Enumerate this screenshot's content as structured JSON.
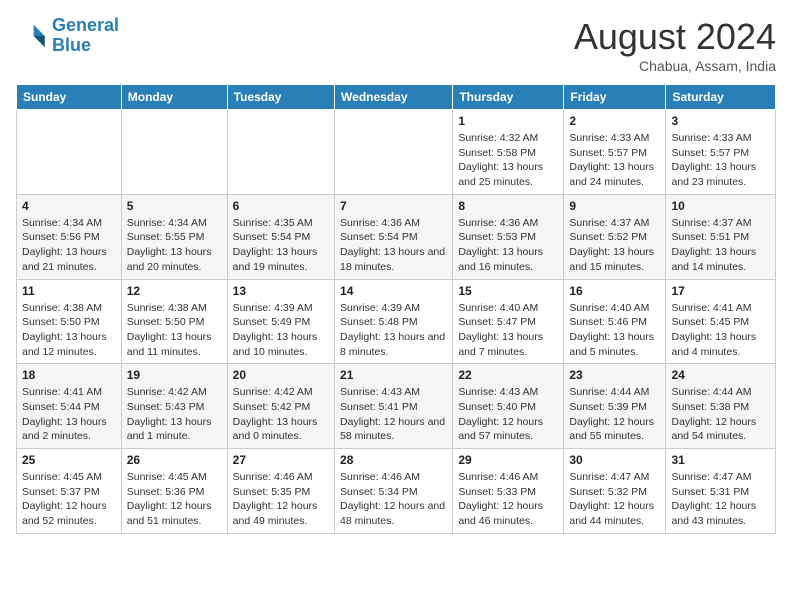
{
  "header": {
    "logo_line1": "General",
    "logo_line2": "Blue",
    "month": "August 2024",
    "location": "Chabua, Assam, India"
  },
  "days_of_week": [
    "Sunday",
    "Monday",
    "Tuesday",
    "Wednesday",
    "Thursday",
    "Friday",
    "Saturday"
  ],
  "weeks": [
    [
      {
        "day": "",
        "info": ""
      },
      {
        "day": "",
        "info": ""
      },
      {
        "day": "",
        "info": ""
      },
      {
        "day": "",
        "info": ""
      },
      {
        "day": "1",
        "info": "Sunrise: 4:32 AM\nSunset: 5:58 PM\nDaylight: 13 hours and 25 minutes."
      },
      {
        "day": "2",
        "info": "Sunrise: 4:33 AM\nSunset: 5:57 PM\nDaylight: 13 hours and 24 minutes."
      },
      {
        "day": "3",
        "info": "Sunrise: 4:33 AM\nSunset: 5:57 PM\nDaylight: 13 hours and 23 minutes."
      }
    ],
    [
      {
        "day": "4",
        "info": "Sunrise: 4:34 AM\nSunset: 5:56 PM\nDaylight: 13 hours and 21 minutes."
      },
      {
        "day": "5",
        "info": "Sunrise: 4:34 AM\nSunset: 5:55 PM\nDaylight: 13 hours and 20 minutes."
      },
      {
        "day": "6",
        "info": "Sunrise: 4:35 AM\nSunset: 5:54 PM\nDaylight: 13 hours and 19 minutes."
      },
      {
        "day": "7",
        "info": "Sunrise: 4:36 AM\nSunset: 5:54 PM\nDaylight: 13 hours and 18 minutes."
      },
      {
        "day": "8",
        "info": "Sunrise: 4:36 AM\nSunset: 5:53 PM\nDaylight: 13 hours and 16 minutes."
      },
      {
        "day": "9",
        "info": "Sunrise: 4:37 AM\nSunset: 5:52 PM\nDaylight: 13 hours and 15 minutes."
      },
      {
        "day": "10",
        "info": "Sunrise: 4:37 AM\nSunset: 5:51 PM\nDaylight: 13 hours and 14 minutes."
      }
    ],
    [
      {
        "day": "11",
        "info": "Sunrise: 4:38 AM\nSunset: 5:50 PM\nDaylight: 13 hours and 12 minutes."
      },
      {
        "day": "12",
        "info": "Sunrise: 4:38 AM\nSunset: 5:50 PM\nDaylight: 13 hours and 11 minutes."
      },
      {
        "day": "13",
        "info": "Sunrise: 4:39 AM\nSunset: 5:49 PM\nDaylight: 13 hours and 10 minutes."
      },
      {
        "day": "14",
        "info": "Sunrise: 4:39 AM\nSunset: 5:48 PM\nDaylight: 13 hours and 8 minutes."
      },
      {
        "day": "15",
        "info": "Sunrise: 4:40 AM\nSunset: 5:47 PM\nDaylight: 13 hours and 7 minutes."
      },
      {
        "day": "16",
        "info": "Sunrise: 4:40 AM\nSunset: 5:46 PM\nDaylight: 13 hours and 5 minutes."
      },
      {
        "day": "17",
        "info": "Sunrise: 4:41 AM\nSunset: 5:45 PM\nDaylight: 13 hours and 4 minutes."
      }
    ],
    [
      {
        "day": "18",
        "info": "Sunrise: 4:41 AM\nSunset: 5:44 PM\nDaylight: 13 hours and 2 minutes."
      },
      {
        "day": "19",
        "info": "Sunrise: 4:42 AM\nSunset: 5:43 PM\nDaylight: 13 hours and 1 minute."
      },
      {
        "day": "20",
        "info": "Sunrise: 4:42 AM\nSunset: 5:42 PM\nDaylight: 13 hours and 0 minutes."
      },
      {
        "day": "21",
        "info": "Sunrise: 4:43 AM\nSunset: 5:41 PM\nDaylight: 12 hours and 58 minutes."
      },
      {
        "day": "22",
        "info": "Sunrise: 4:43 AM\nSunset: 5:40 PM\nDaylight: 12 hours and 57 minutes."
      },
      {
        "day": "23",
        "info": "Sunrise: 4:44 AM\nSunset: 5:39 PM\nDaylight: 12 hours and 55 minutes."
      },
      {
        "day": "24",
        "info": "Sunrise: 4:44 AM\nSunset: 5:38 PM\nDaylight: 12 hours and 54 minutes."
      }
    ],
    [
      {
        "day": "25",
        "info": "Sunrise: 4:45 AM\nSunset: 5:37 PM\nDaylight: 12 hours and 52 minutes."
      },
      {
        "day": "26",
        "info": "Sunrise: 4:45 AM\nSunset: 5:36 PM\nDaylight: 12 hours and 51 minutes."
      },
      {
        "day": "27",
        "info": "Sunrise: 4:46 AM\nSunset: 5:35 PM\nDaylight: 12 hours and 49 minutes."
      },
      {
        "day": "28",
        "info": "Sunrise: 4:46 AM\nSunset: 5:34 PM\nDaylight: 12 hours and 48 minutes."
      },
      {
        "day": "29",
        "info": "Sunrise: 4:46 AM\nSunset: 5:33 PM\nDaylight: 12 hours and 46 minutes."
      },
      {
        "day": "30",
        "info": "Sunrise: 4:47 AM\nSunset: 5:32 PM\nDaylight: 12 hours and 44 minutes."
      },
      {
        "day": "31",
        "info": "Sunrise: 4:47 AM\nSunset: 5:31 PM\nDaylight: 12 hours and 43 minutes."
      }
    ]
  ]
}
